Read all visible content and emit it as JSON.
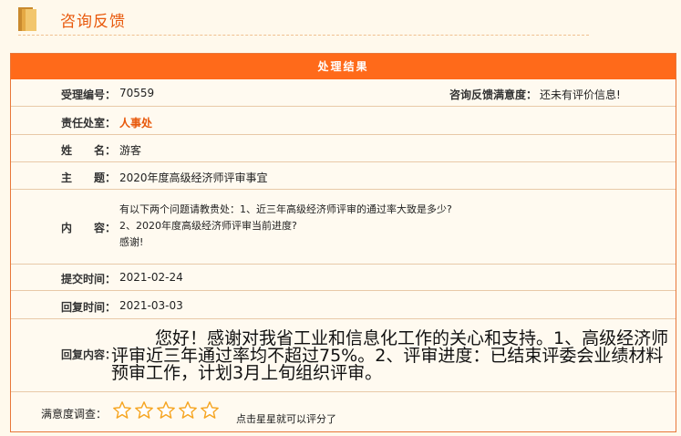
{
  "header": {
    "title": "咨询反馈"
  },
  "panel": {
    "heading": "处理结果",
    "accept_no_label": "受理编号：",
    "accept_no": "70559",
    "satisfaction_label": "咨询反馈满意度：",
    "satisfaction_value": "还未有评价信息!",
    "dept_label": "责任处室：",
    "dept_value": "人事处",
    "name_label": "姓　　名：",
    "name_value": "游客",
    "subject_label": "主　　题：",
    "subject_value": "2020年度高级经济师评审事宜",
    "content_label": "内　　容：",
    "content_lines": [
      "有以下两个问题请教贵处：1、近三年高级经济师评审的通过率大致是多少?",
      "2、2020年度高级经济师评审当前进度?",
      "感谢!"
    ],
    "submit_label": "提交时间：",
    "submit_value": "2021-02-24",
    "reply_time_label": "回复时间：",
    "reply_time_value": "2021-03-03",
    "reply_label": "回复内容：",
    "reply_value": "您好！感谢对我省工业和信息化工作的关心和支持。1、高级经济师评审近三年通过率均不超过75%。2、评审进度：已结束评委会业绩材料预审工作，计划3月上旬组织评审。"
  },
  "rating": {
    "label": "满意度调查：",
    "hint": "点击星星就可以评分了",
    "stars": 5,
    "star_color": "#f6a623"
  },
  "colors": {
    "accent": "#ff6a1a",
    "title": "#e8590c",
    "background": "#fff9ec"
  }
}
